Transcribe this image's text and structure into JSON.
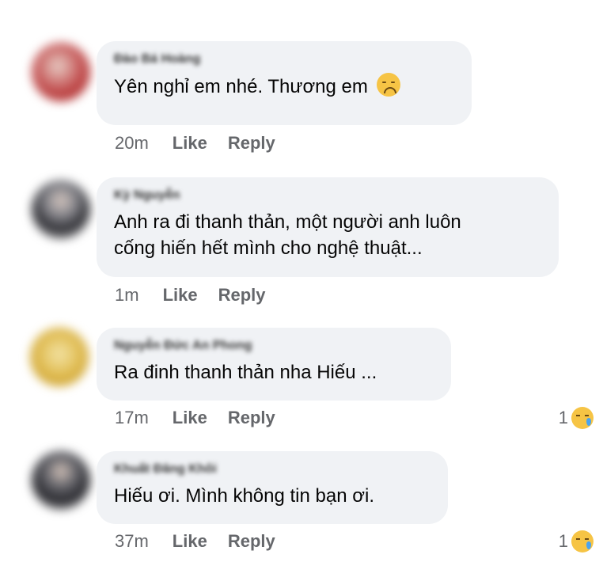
{
  "comments": [
    {
      "author": "Đào Bá Hoàng",
      "text": "Yên nghỉ em nhé. Thương em",
      "has_emoji": true,
      "time": "20m",
      "like": "Like",
      "reply": "Reply",
      "avatar_color": "#c23a3a",
      "reaction_count": null
    },
    {
      "author": "Kỳ Nguyễn",
      "text": "Anh ra đi thanh thản, một người anh luôn\ncống hiến hết mình cho nghệ thuật...",
      "has_emoji": false,
      "time": "1m",
      "like": "Like",
      "reply": "Reply",
      "avatar_color": "#2e2e33",
      "reaction_count": null
    },
    {
      "author": "Nguyễn Đức An Phong",
      "text": "Ra đinh thanh thản nha Hiếu ...",
      "has_emoji": false,
      "time": "17m",
      "like": "Like",
      "reply": "Reply",
      "avatar_color": "#d4a72c",
      "reaction_count": "1"
    },
    {
      "author": "Khuất Đăng Khôi",
      "text": "Hiếu ơi. Mình không tin bạn ơi.",
      "has_emoji": false,
      "time": "37m",
      "like": "Like",
      "reply": "Reply",
      "avatar_color": "#26262b",
      "reaction_count": "1"
    }
  ],
  "icons": {
    "sad_emoji": "disappointed-face-icon",
    "reaction": "crying-face-icon"
  }
}
